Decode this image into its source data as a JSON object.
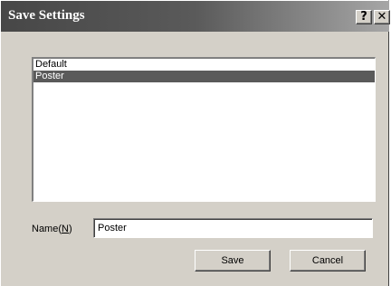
{
  "window": {
    "title": "Save Settings",
    "help_glyph": "?",
    "close_glyph": "✕",
    "titlebar_color": "#4a4a4a",
    "selection_color": "#5a5a5a"
  },
  "settings_list": {
    "items": [
      {
        "label": "Default",
        "selected": false
      },
      {
        "label": "Poster",
        "selected": true
      }
    ]
  },
  "name_field": {
    "label_prefix": "Name(",
    "label_mnemonic": "N",
    "label_suffix": ")",
    "value": "Poster"
  },
  "buttons": {
    "save_label": "Save",
    "cancel_label": "Cancel"
  }
}
